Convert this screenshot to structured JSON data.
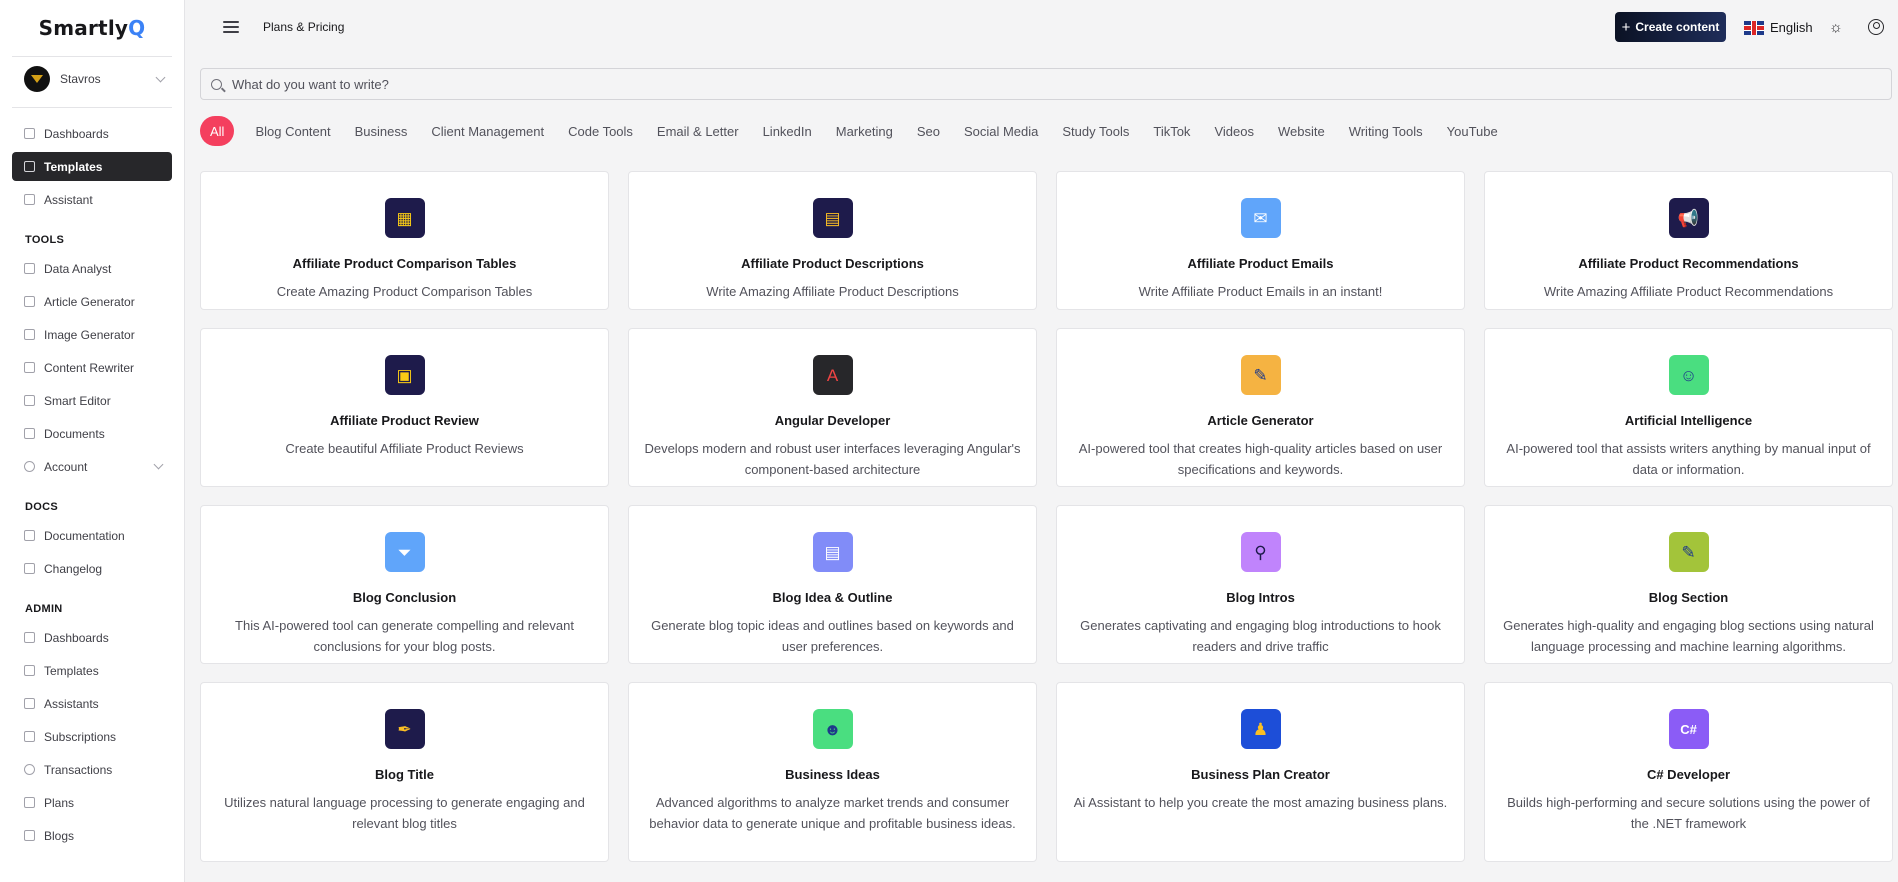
{
  "brand": {
    "name_main": "Smartly",
    "name_accent": "Q"
  },
  "user": {
    "name": "Stavros"
  },
  "nav_main": [
    {
      "label": "Dashboards",
      "active": false
    },
    {
      "label": "Templates",
      "active": true
    },
    {
      "label": "Assistant",
      "active": false
    }
  ],
  "tools": {
    "heading": "TOOLS",
    "items": [
      "Data Analyst",
      "Article Generator",
      "Image Generator",
      "Content Rewriter",
      "Smart Editor",
      "Documents",
      "Account"
    ]
  },
  "docs": {
    "heading": "DOCS",
    "items": [
      "Documentation",
      "Changelog"
    ]
  },
  "admin": {
    "heading": "ADMIN",
    "items": [
      "Dashboards",
      "Templates",
      "Assistants",
      "Subscriptions",
      "Transactions",
      "Plans",
      "Blogs"
    ]
  },
  "topbar": {
    "breadcrumb": "Plans & Pricing",
    "create_label": "Create content",
    "language": "English"
  },
  "search": {
    "placeholder": "What do you want to write?"
  },
  "filters": [
    "All",
    "Blog Content",
    "Business",
    "Client Management",
    "Code Tools",
    "Email & Letter",
    "LinkedIn",
    "Marketing",
    "Seo",
    "Social Media",
    "Study Tools",
    "TikTok",
    "Videos",
    "Website",
    "Writing Tools",
    "YouTube"
  ],
  "filter_active": "All",
  "templates": [
    {
      "title": "Affiliate Product Comparison Tables",
      "desc": "Create Amazing Product Comparison Tables",
      "icon": "grid-icon",
      "glyph": "▦",
      "color": "#1e1b4b",
      "glyph_color": "#facc15"
    },
    {
      "title": "Affiliate Product Descriptions",
      "desc": "Write Amazing Affiliate Product Descriptions",
      "icon": "note-icon",
      "glyph": "▤",
      "color": "#1e1b4b",
      "glyph_color": "#fbbf24"
    },
    {
      "title": "Affiliate Product Emails",
      "desc": "Write Affiliate Product Emails in an instant!",
      "icon": "envelope-icon",
      "glyph": "✉",
      "color": "#60a5fa",
      "glyph_color": "#ffffff"
    },
    {
      "title": "Affiliate Product Recommendations",
      "desc": "Write Amazing Affiliate Product Recommendations",
      "icon": "megaphone-icon",
      "glyph": "📢",
      "color": "#1e1b4b",
      "glyph_color": "#fbbf24"
    },
    {
      "title": "Affiliate Product Review",
      "desc": "Create beautiful Affiliate Product Reviews",
      "icon": "review-card-icon",
      "glyph": "▣",
      "color": "#1e1b4b",
      "glyph_color": "#facc15"
    },
    {
      "title": "Angular Developer",
      "desc": "Develops modern and robust user interfaces leveraging Angular's component-based architecture",
      "icon": "angular-icon",
      "glyph": "A",
      "color": "#27272a",
      "glyph_color": "#ef4444"
    },
    {
      "title": "Article Generator",
      "desc": "AI-powered tool that creates high-quality articles based on user specifications and keywords.",
      "icon": "pen-icon",
      "glyph": "✎",
      "color": "#f5b342",
      "glyph_color": "#1e3a8a"
    },
    {
      "title": "Artificial Intelligence",
      "desc": "AI-powered tool that assists writers anything by manual input of data or information.",
      "icon": "brain-icon",
      "glyph": "☺",
      "color": "#4ade80",
      "glyph_color": "#1e3a8a"
    },
    {
      "title": "Blog Conclusion",
      "desc": "This AI-powered tool can generate compelling and relevant conclusions for your blog posts.",
      "icon": "funnel-icon",
      "glyph": "⏷",
      "color": "#60a5fa",
      "glyph_color": "#ffffff"
    },
    {
      "title": "Blog Idea & Outline",
      "desc": "Generate blog topic ideas and outlines based on keywords and user preferences.",
      "icon": "document-search-icon",
      "glyph": "▤",
      "color": "#818cf8",
      "glyph_color": "#ffffff"
    },
    {
      "title": "Blog Intros",
      "desc": "Generates captivating and engaging blog introductions to hook readers and drive traffic",
      "icon": "magnifier-icon",
      "glyph": "⚲",
      "color": "#c084fc",
      "glyph_color": "#1e1b4b"
    },
    {
      "title": "Blog Section",
      "desc": "Generates high-quality and engaging blog sections using natural language processing and machine learning algorithms.",
      "icon": "pencil-icon",
      "glyph": "✎",
      "color": "#a3c43a",
      "glyph_color": "#1e3a8a"
    },
    {
      "title": "Blog Title",
      "desc": "Utilizes natural language processing to generate engaging and relevant blog titles",
      "icon": "pen-nib-icon",
      "glyph": "✒",
      "color": "#1e1b4b",
      "glyph_color": "#fbbf24"
    },
    {
      "title": "Business Ideas",
      "desc": "Advanced algorithms to analyze market trends and consumer behavior data to generate unique and profitable business ideas.",
      "icon": "businessman-icon",
      "glyph": "☻",
      "color": "#4ade80",
      "glyph_color": "#1e3a8a"
    },
    {
      "title": "Business Plan Creator",
      "desc": "Ai Assistant to help you create the most amazing business plans.",
      "icon": "presenter-icon",
      "glyph": "♟",
      "color": "#1d4ed8",
      "glyph_color": "#fbbf24"
    },
    {
      "title": "C# Developer",
      "desc": "Builds high-performing and secure solutions using the power of the .NET framework",
      "icon": "csharp-icon",
      "glyph": "C#",
      "color": "#8b5cf6",
      "glyph_color": "#ffffff"
    }
  ]
}
